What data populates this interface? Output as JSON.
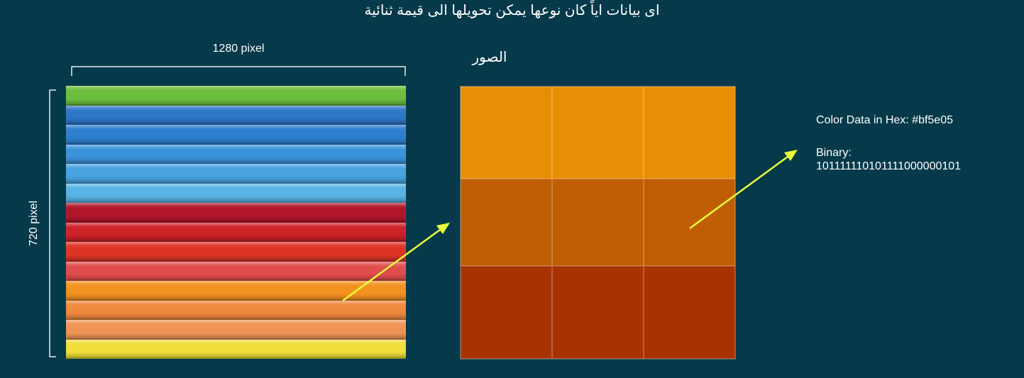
{
  "title": "اى بيانات اياً كان نوعها يمكن تحويلها الى قيمة ثنائية",
  "image_caption": "الصور",
  "dimensions": {
    "width_label": "1280 pixel",
    "height_label": "720 pixel"
  },
  "pencils": [
    {
      "name": "green",
      "color": "#6cbf3c"
    },
    {
      "name": "blue-1",
      "color": "#2d76c8"
    },
    {
      "name": "blue-2",
      "color": "#2f7fd0"
    },
    {
      "name": "blue-3",
      "color": "#3b93db"
    },
    {
      "name": "blue-4",
      "color": "#48a3e0"
    },
    {
      "name": "blue-5",
      "color": "#58b3e6"
    },
    {
      "name": "dark-red",
      "color": "#b1162a"
    },
    {
      "name": "red-1",
      "color": "#cc2228"
    },
    {
      "name": "red-2",
      "color": "#dc3526"
    },
    {
      "name": "red-3",
      "color": "#e04d4c"
    },
    {
      "name": "orange-1",
      "color": "#f39221"
    },
    {
      "name": "orange-2",
      "color": "#ef8a3e"
    },
    {
      "name": "orange-3",
      "color": "#f09556"
    },
    {
      "name": "yellow",
      "color": "#f0df3a"
    }
  ],
  "zoom_colors": [
    "#e88e05",
    "#bf5e05",
    "#a83200"
  ],
  "arrow_color": "#eaff3a",
  "color_info": {
    "hex_line": "Color Data in Hex: #bf5e05",
    "binary_label": "Binary:",
    "binary_value": "101111110101111000000101"
  }
}
